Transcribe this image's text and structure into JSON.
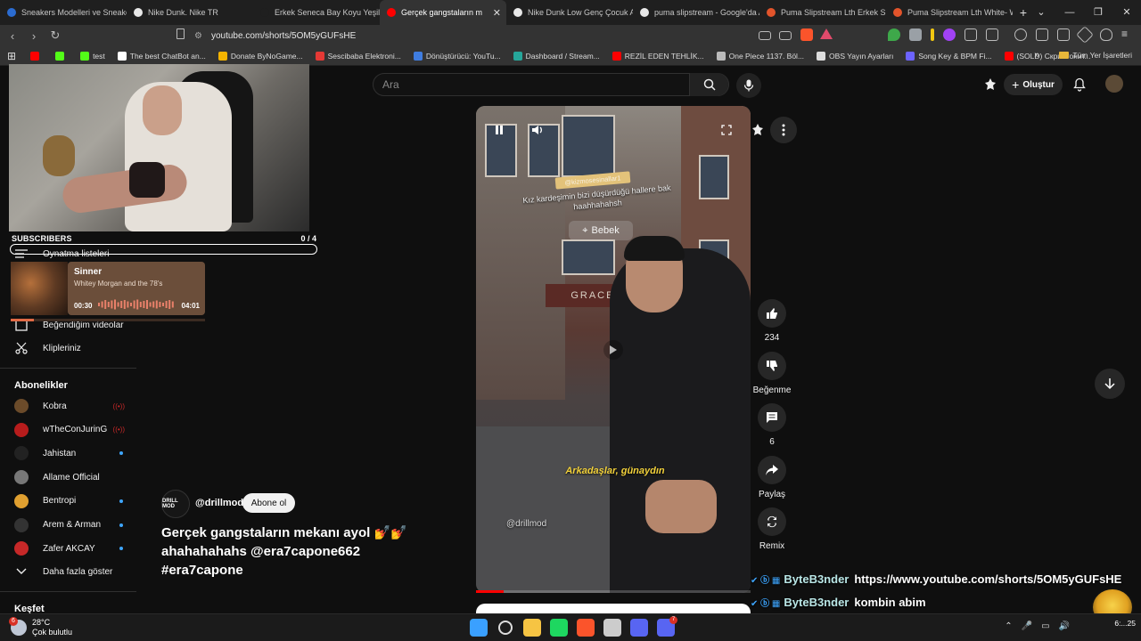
{
  "browser": {
    "tabs": [
      {
        "label": "Sneakers Modelleri ve Sneakers",
        "color": "#2b6cd1",
        "active": false
      },
      {
        "label": "Nike Dunk. Nike TR",
        "color": "#e8e8e8",
        "active": false
      },
      {
        "label": "Erkek Seneca Bay Koyu Yeşil Sp",
        "color": "#1f1f1f",
        "active": false
      },
      {
        "label": "Gerçek gangstaların m",
        "color": "#ff0000",
        "active": true
      },
      {
        "label": "Nike Dunk Low Genç Çocuk Ay",
        "color": "#e8e8e8",
        "active": false
      },
      {
        "label": "puma slipstream - Google'da A",
        "color": "#e8e8e8",
        "active": false
      },
      {
        "label": "Puma Slipstream Lth Erkek Sne",
        "color": "#e2542b",
        "active": false
      },
      {
        "label": "Puma Slipstream Lth White- W",
        "color": "#e2542b",
        "active": false
      }
    ],
    "new_tab": "+",
    "tab_close": "✕",
    "window_controls": [
      "⌄",
      "—",
      "❐",
      "✕"
    ],
    "url": "youtube.com/shorts/5OM5yGUFsHE",
    "bookmarks": [
      {
        "label": "",
        "color": "#ff0000"
      },
      {
        "label": "",
        "color": "#53fc18"
      },
      {
        "label": "test",
        "color": "#53fc18"
      },
      {
        "label": "The best ChatBot an...",
        "color": "#ffffff"
      },
      {
        "label": "Donate ByNoGame...",
        "color": "#f5b400"
      },
      {
        "label": "Sescibaba Elektroni...",
        "color": "#e53935"
      },
      {
        "label": "Dönüştürücü: YouTu...",
        "color": "#3f7de0"
      },
      {
        "label": "Dashboard / Stream...",
        "color": "#26a69a"
      },
      {
        "label": "REZİL EDEN TEHLİK...",
        "color": "#ff0000"
      },
      {
        "label": "One Piece 1137. Böl...",
        "color": "#bbbbbb"
      },
      {
        "label": "OBS Yayın Ayarları",
        "color": "#dddddd"
      },
      {
        "label": "Song Key & BPM Fi...",
        "color": "#6c63ff"
      },
      {
        "label": "(SOLD) Скриптонит...",
        "color": "#ff0000"
      }
    ],
    "bookmarks_more": "»",
    "all_bookmarks": "Tüm Yer İşaretleri"
  },
  "youtube": {
    "search_placeholder": "Ara",
    "create_label": "Oluştur",
    "sidebar": {
      "items_visible": [
        {
          "label": "Oynatma listeleri",
          "icon": "playlist-icon"
        },
        {
          "label": "Beğendiğim videolar",
          "icon": "like-icon"
        },
        {
          "label": "Klipleriniz",
          "icon": "clip-icon"
        }
      ],
      "subscriptions_title": "Abonelikler",
      "channels": [
        {
          "name": "Kobra",
          "status": "live",
          "color": "#6b4b2a"
        },
        {
          "name": "wTheConJurinG",
          "status": "live",
          "color": "#b71c1c"
        },
        {
          "name": "Jahistan",
          "status": "new",
          "color": "#222222"
        },
        {
          "name": "Allame Official",
          "status": "none",
          "color": "#777777"
        },
        {
          "name": "Bentropi",
          "status": "new",
          "color": "#e0a030"
        },
        {
          "name": "Arem & Arman",
          "status": "new",
          "color": "#333333"
        },
        {
          "name": "Zafer AKCAY",
          "status": "new",
          "color": "#c62828"
        }
      ],
      "show_more": "Daha fazla göster",
      "explore_title": "Keşfet",
      "live_glyph": "((•))"
    },
    "video": {
      "channel": "@drillmod",
      "channel_avatar_text": "DRILL MOD",
      "subscribe_label": "Abone ol",
      "title": "Gerçek gangstaların mekanı ayol 💅💅 ahahahahahs @era7capone662 #era7capone",
      "overlay_tag": "@kizmosesinallar1",
      "overlay_caption": "Kız kardeşimin bizi düşürdüğü hallere bak haahhahahsh",
      "location": "Bebek",
      "storefront_sign": "GRACE ROSE",
      "subtitle": "Arkadaşlar, günaydın",
      "watermark": "@drillmod",
      "progress": 0.1
    },
    "actions": [
      {
        "icon": "like-icon",
        "label": "234"
      },
      {
        "icon": "dislike-icon",
        "label": "Beğenme"
      },
      {
        "icon": "comment-icon",
        "label": "6"
      },
      {
        "icon": "share-icon",
        "label": "Paylaş"
      },
      {
        "icon": "remix-icon",
        "label": "Remix"
      }
    ]
  },
  "stream_overlay": {
    "subscribers_label": "SUBSCRIBERS",
    "subscribers_count": "0  / 4",
    "now_playing": {
      "title": "Sinner",
      "artist": "Whitey Morgan and the 78's",
      "elapsed": "00:30",
      "duration": "04:01"
    },
    "chat": [
      {
        "user": "ByteB3nder",
        "message": "https://www.youtube.com/shorts/5OM5yGUFsHE"
      },
      {
        "user": "ByteB3nder",
        "message": "kombin abim"
      }
    ],
    "chat_badges": "✔ ⓑ ▦"
  },
  "taskbar": {
    "temperature": "28°C",
    "condition": "Çok bulutlu",
    "weather_badge": "6",
    "apps": [
      {
        "name": "start",
        "color": "#3aa0ff"
      },
      {
        "name": "search",
        "color": "#dddddd"
      },
      {
        "name": "explorer",
        "color": "#f6c443"
      },
      {
        "name": "spotify",
        "color": "#1ed760"
      },
      {
        "name": "brave",
        "color": "#fb542b"
      },
      {
        "name": "obs",
        "color": "#cccccc"
      },
      {
        "name": "discord",
        "color": "#5865f2"
      },
      {
        "name": "discord-2",
        "color": "#5865f2"
      }
    ],
    "discord_badge": "7",
    "tray_glyphs": [
      "⌃",
      "🎤",
      "▭",
      "🔊"
    ],
    "clock": "6:...25"
  }
}
